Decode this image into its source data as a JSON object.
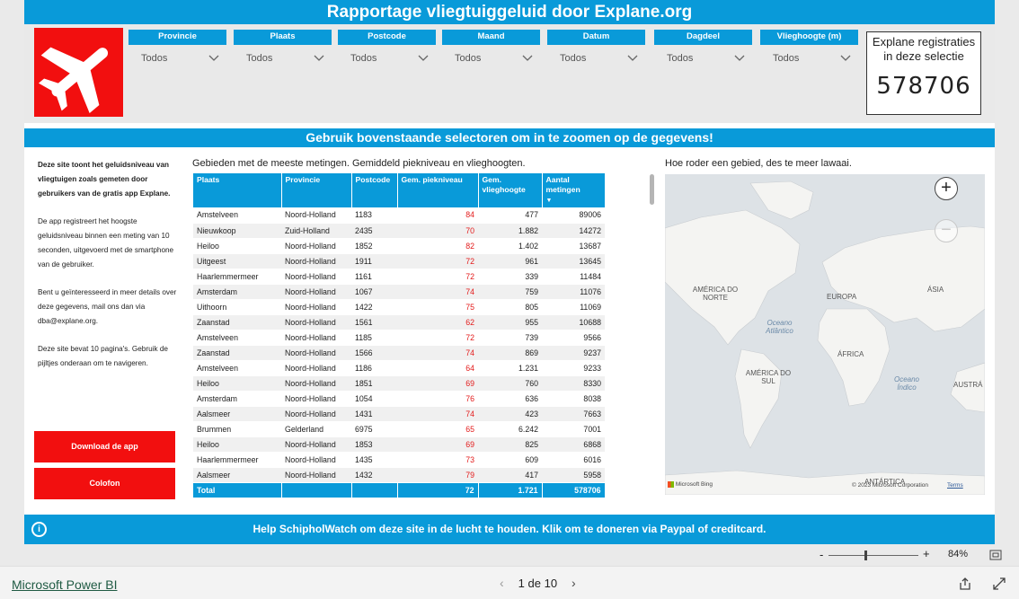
{
  "title": "Rapportage vliegtuiggeluid door Explane.org",
  "slicers": [
    {
      "label": "Provincie",
      "value": "Todos"
    },
    {
      "label": "Plaats",
      "value": "Todos"
    },
    {
      "label": "Postcode",
      "value": "Todos"
    },
    {
      "label": "Maand",
      "value": "Todos"
    },
    {
      "label": "Datum",
      "value": "Todos"
    },
    {
      "label": "Dagdeel",
      "value": "Todos"
    },
    {
      "label": "Vlieghoogte (m)",
      "value": "Todos"
    }
  ],
  "card": {
    "label": "Explane registraties in deze selectie",
    "value": "578706"
  },
  "subtitle": "Gebruik bovenstaande selectoren om in te zoomen op de gegevens!",
  "intro": {
    "p1": "Deze site toont het geluidsniveau van vliegtuigen zoals gemeten door gebruikers van de gratis app Explane.",
    "p2": "De app registreert het hoogste geluidsniveau binnen een meting van 10 seconden, uitgevoerd met de smartphone van de gebruiker.",
    "p3": "Bent u geïnteresseerd in meer details over deze gegevens, mail ons dan via dba@explane.org.",
    "p4": "Deze site bevat 10 pagina's. Gebruik de pijltjes onderaan om te navigeren."
  },
  "buttons": {
    "download": "Download de app",
    "colofon": "Colofon"
  },
  "table": {
    "caption": "Gebieden met de meeste metingen. Gemiddeld piekniveau en vlieghoogten.",
    "headers": [
      "Plaats",
      "Provincie",
      "Postcode",
      "Gem. piekniveau",
      "Gem. vlieghoogte",
      "Aantal metingen"
    ],
    "rows": [
      [
        "Amstelveen",
        "Noord-Holland",
        "1183",
        "84",
        "477",
        "89006"
      ],
      [
        "Nieuwkoop",
        "Zuid-Holland",
        "2435",
        "70",
        "1.882",
        "14272"
      ],
      [
        "Heiloo",
        "Noord-Holland",
        "1852",
        "82",
        "1.402",
        "13687"
      ],
      [
        "Uitgeest",
        "Noord-Holland",
        "1911",
        "72",
        "961",
        "13645"
      ],
      [
        "Haarlemmermeer",
        "Noord-Holland",
        "1161",
        "72",
        "339",
        "11484"
      ],
      [
        "Amsterdam",
        "Noord-Holland",
        "1067",
        "74",
        "759",
        "11076"
      ],
      [
        "Uithoorn",
        "Noord-Holland",
        "1422",
        "75",
        "805",
        "11069"
      ],
      [
        "Zaanstad",
        "Noord-Holland",
        "1561",
        "62",
        "955",
        "10688"
      ],
      [
        "Amstelveen",
        "Noord-Holland",
        "1185",
        "72",
        "739",
        "9566"
      ],
      [
        "Zaanstad",
        "Noord-Holland",
        "1566",
        "74",
        "869",
        "9237"
      ],
      [
        "Amstelveen",
        "Noord-Holland",
        "1186",
        "64",
        "1.231",
        "9233"
      ],
      [
        "Heiloo",
        "Noord-Holland",
        "1851",
        "69",
        "760",
        "8330"
      ],
      [
        "Amsterdam",
        "Noord-Holland",
        "1054",
        "76",
        "636",
        "8038"
      ],
      [
        "Aalsmeer",
        "Noord-Holland",
        "1431",
        "74",
        "423",
        "7663"
      ],
      [
        "Brummen",
        "Gelderland",
        "6975",
        "65",
        "6.242",
        "7001"
      ],
      [
        "Heiloo",
        "Noord-Holland",
        "1853",
        "69",
        "825",
        "6868"
      ],
      [
        "Haarlemmermeer",
        "Noord-Holland",
        "1435",
        "73",
        "609",
        "6016"
      ],
      [
        "Aalsmeer",
        "Noord-Holland",
        "1432",
        "79",
        "417",
        "5958"
      ]
    ],
    "total": {
      "label": "Total",
      "piekniveau": "72",
      "vlieghoogte": "1.721",
      "metingen": "578706"
    }
  },
  "map": {
    "caption": "Hoe roder een gebied, des te meer lawaai.",
    "labels": {
      "north_america": "AMÉRICA DO NORTE",
      "europe": "EUROPA",
      "asia": "ÁSIA",
      "atlantic": "Oceano Atlântico",
      "africa": "ÁFRICA",
      "south_america": "AMÉRICA DO SUL",
      "indian": "Oceano Índico",
      "australia": "AUSTRÁ",
      "antarctica": "ANTÁRTICA"
    },
    "bing": "Microsoft Bing",
    "copyright": "© 2023 Microsoft Corporation",
    "terms": "Terms"
  },
  "donate": "Help SchipholWatch om deze site in de lucht te houden. Klik om te doneren via Paypal of creditcard.",
  "zoom": {
    "minus": "-",
    "plus": "+",
    "level": "84%"
  },
  "footer": {
    "app": "Microsoft Power BI",
    "page": "1 de 10"
  },
  "colors": {
    "accent": "#099ad9",
    "red": "#f20f0f"
  }
}
